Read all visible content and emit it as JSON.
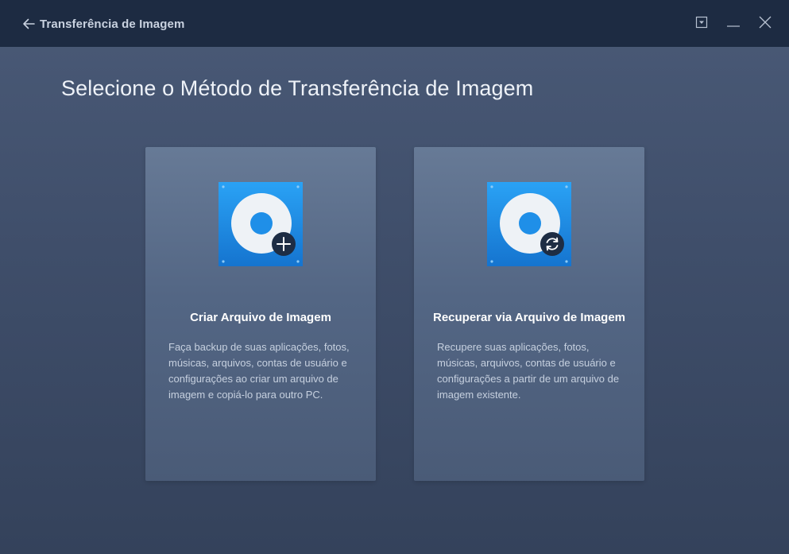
{
  "header": {
    "title": "Transferência de Imagem",
    "back_icon": "arrow-left-icon",
    "controls": [
      "dropdown-menu-icon",
      "minimize-icon",
      "close-icon"
    ]
  },
  "main": {
    "heading": "Selecione o Método de Transferência de Imagem",
    "cards": [
      {
        "title": "Criar Arquivo de Imagem",
        "description": "Faça backup de suas aplicações, fotos, músicas, arquivos, contas de usuário e configurações ao criar um arquivo de imagem e copiá-lo para outro PC.",
        "icon": "disk-add-icon"
      },
      {
        "title": "Recuperar via Arquivo de Imagem",
        "description": "Recupere suas aplicações, fotos, músicas, arquivos, contas de usuário e configurações a partir de um arquivo de imagem existente.",
        "icon": "disk-restore-icon"
      }
    ]
  },
  "colors": {
    "titlebar": "#1d2b42",
    "background": "#3f4e6a",
    "card": "#5a6d8a",
    "icon_blue": "#1f8fe8",
    "badge": "#1e2d44"
  }
}
